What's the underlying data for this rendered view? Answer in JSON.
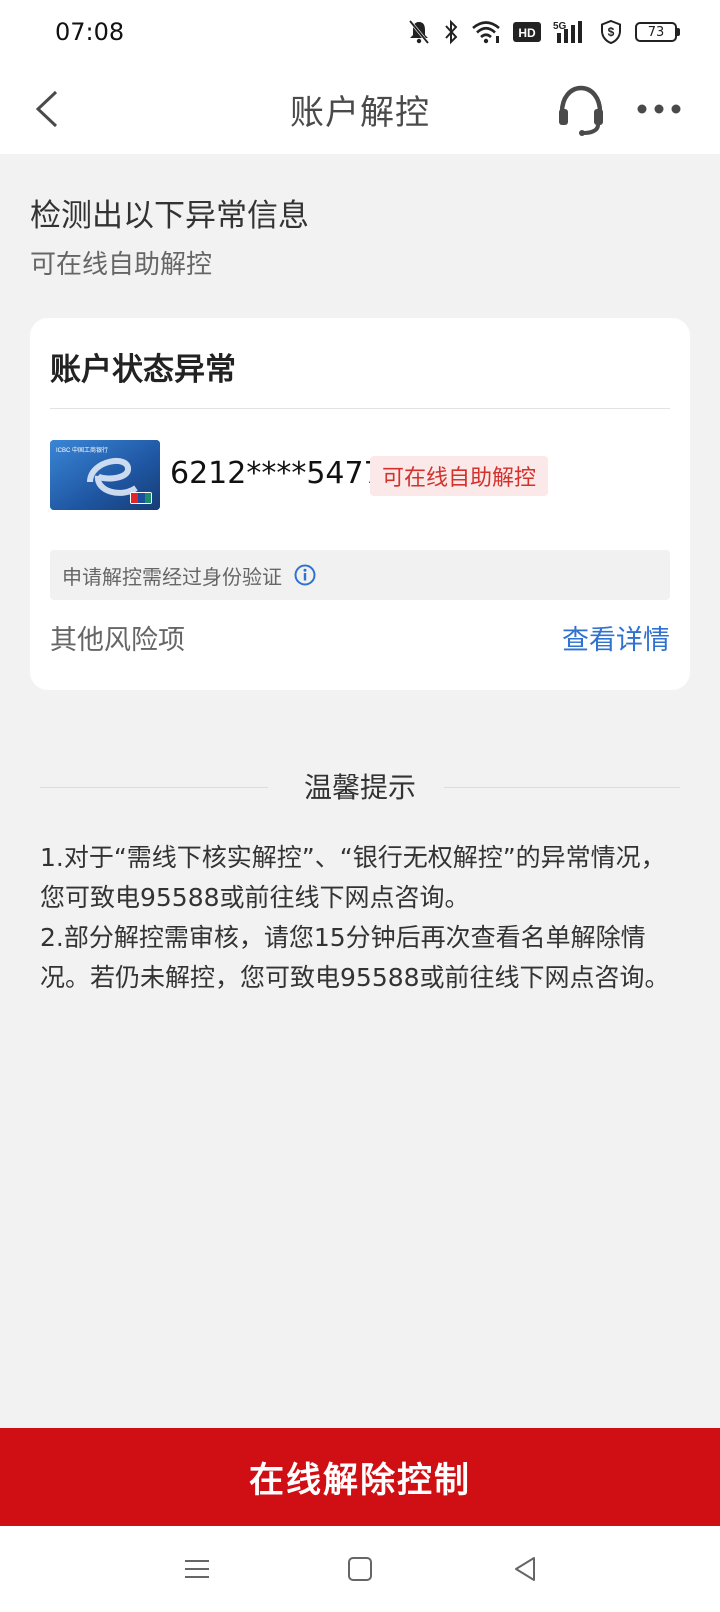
{
  "status_bar": {
    "time": "07:08",
    "icons": [
      "mute-bell-icon",
      "bluetooth-icon",
      "wifi-icon",
      "hd-icon",
      "5g-signal-icon",
      "shield-dollar-icon",
      "battery-icon"
    ],
    "hd_label": "HD",
    "network_label": "5G",
    "battery": "73"
  },
  "header": {
    "title": "账户解控",
    "back_icon": "chevron-left-icon",
    "service_icon": "headset-icon",
    "more_icon": "more-dots-icon"
  },
  "detect": {
    "title": "检测出以下异常信息",
    "subtitle": "可在线自助解控"
  },
  "card": {
    "title": "账户状态异常",
    "bank_card_text": "ICBC 中国工商银行",
    "card_number": "6212****5477",
    "tag": "可在线自助解控",
    "verify_note": "申请解控需经过身份验证",
    "risk_label": "其他风险项",
    "risk_link": "查看详情"
  },
  "tips": {
    "title": "温馨提示",
    "line1": "1.对于“需线下核实解控”、“银行无权解控”的异常情况，您可致电95588或前往线下网点咨询。",
    "line2": "2.部分解控需审核，请您15分钟后再次查看名单解除情况。若仍未解控，您可致电95588或前往线下网点咨询。"
  },
  "action": {
    "button_label": "在线解除控制"
  },
  "colors": {
    "accent_red": "#d00f14",
    "link_blue": "#2f72d0",
    "tag_red": "#d4312c"
  }
}
